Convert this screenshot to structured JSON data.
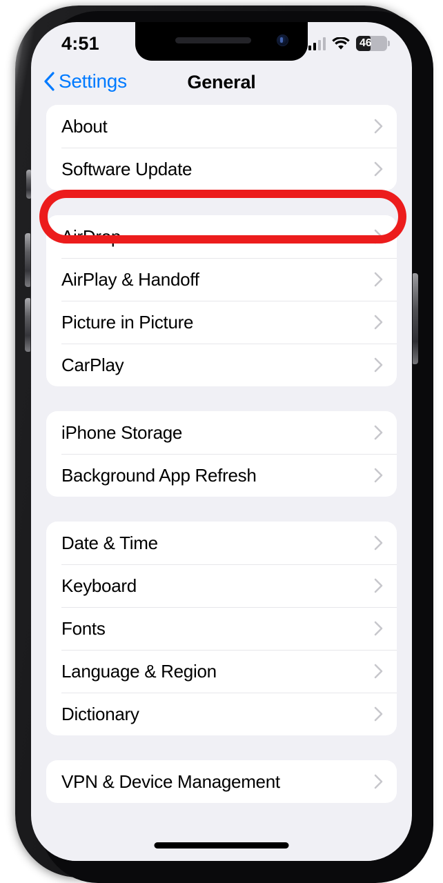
{
  "device": {
    "type": "iphone",
    "frame_color": "#141416"
  },
  "status_bar": {
    "time": "4:51",
    "cellular_icon": "cellular-bars-icon",
    "wifi_icon": "wifi-icon",
    "battery_level": "46",
    "battery_percent": 46
  },
  "nav_bar": {
    "back_label": "Settings",
    "back_icon": "chevron-left-icon",
    "title": "General"
  },
  "groups": [
    {
      "rows": [
        {
          "label": "About",
          "chevron": "chevron-right-icon"
        },
        {
          "label": "Software Update",
          "chevron": "chevron-right-icon",
          "highlighted": true
        }
      ]
    },
    {
      "rows": [
        {
          "label": "AirDrop",
          "chevron": "chevron-right-icon"
        },
        {
          "label": "AirPlay & Handoff",
          "chevron": "chevron-right-icon"
        },
        {
          "label": "Picture in Picture",
          "chevron": "chevron-right-icon"
        },
        {
          "label": "CarPlay",
          "chevron": "chevron-right-icon"
        }
      ]
    },
    {
      "rows": [
        {
          "label": "iPhone Storage",
          "chevron": "chevron-right-icon"
        },
        {
          "label": "Background App Refresh",
          "chevron": "chevron-right-icon"
        }
      ]
    },
    {
      "rows": [
        {
          "label": "Date & Time",
          "chevron": "chevron-right-icon"
        },
        {
          "label": "Keyboard",
          "chevron": "chevron-right-icon"
        },
        {
          "label": "Fonts",
          "chevron": "chevron-right-icon"
        },
        {
          "label": "Language & Region",
          "chevron": "chevron-right-icon"
        },
        {
          "label": "Dictionary",
          "chevron": "chevron-right-icon"
        }
      ]
    },
    {
      "rows": [
        {
          "label": "VPN & Device Management",
          "chevron": "chevron-right-icon"
        }
      ]
    }
  ],
  "annotation": {
    "type": "oval-highlight",
    "color": "#ec1c1c",
    "targets": "Software Update"
  },
  "colors": {
    "accent_blue": "#007aff",
    "screen_background": "#f0f0f5",
    "card_background": "#ffffff",
    "chevron_gray": "#c7c7cc",
    "highlight_red": "#ec1c1c"
  }
}
